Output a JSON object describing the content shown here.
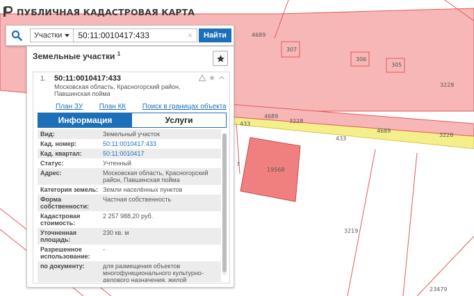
{
  "app": {
    "title": "ПУБЛИЧНАЯ КАДАСТРОВАЯ КАРТА"
  },
  "search": {
    "type_label": "Участки",
    "value": "50:11:0010417:433",
    "button_label": "Найти",
    "clear_glyph": "×"
  },
  "panel": {
    "title": "Земельные участки",
    "count": "1"
  },
  "card": {
    "index": "1.",
    "cadastral_number": "50:11:0010417:433",
    "address": "Московская область, Красногорский район, Павшинская пойма",
    "links": [
      {
        "label": "План ЗУ →"
      },
      {
        "label": "План КК →"
      },
      {
        "label": "Поиск в границах объекта →"
      }
    ],
    "tabs": [
      {
        "label": "Информация",
        "active": true
      },
      {
        "label": "Услуги",
        "active": false
      }
    ],
    "properties": [
      {
        "label": "Вид:",
        "value": "Земельный участок"
      },
      {
        "label": "Кад. номер:",
        "value": "50:11:0010417:433",
        "link": true
      },
      {
        "label": "Кад. квартал:",
        "value": "50:11:0010417",
        "link": true
      },
      {
        "label": "Статус:",
        "value": "Учтенный"
      },
      {
        "label": "Адрес:",
        "value": "Московская область, Красногорский район, Павшинская пойма"
      },
      {
        "label": "Категория земель:",
        "value": "Земли населённых пунктов"
      },
      {
        "label": "Форма собственности:",
        "value": "Частная собственность"
      },
      {
        "label": "Кадастровая стоимость:",
        "value": "2 257 988,20 руб."
      },
      {
        "label": "Уточненная площадь:",
        "value": "230 кв. м"
      },
      {
        "label": "Разрешенное использование:",
        "value": "-"
      },
      {
        "label": "по документу:",
        "value": "для размещения объектов многофункционального культурно-делового назначения, жилой застройки, гостиничного комплекса и спортивного назначения"
      }
    ]
  },
  "map": {
    "labels": [
      {
        "text": "4689"
      },
      {
        "text": "307"
      },
      {
        "text": "306"
      },
      {
        "text": "305"
      },
      {
        "text": "3228"
      },
      {
        "text": "433"
      },
      {
        "text": "4689"
      },
      {
        "text": "3228"
      },
      {
        "text": "4689"
      },
      {
        "text": "433"
      },
      {
        "text": "3228"
      },
      {
        "text": "19568"
      },
      {
        "text": "3219"
      },
      {
        "text": "23479"
      },
      {
        "text": "7"
      }
    ]
  },
  "colors": {
    "accent": "#1d6fb8",
    "parcel_fill": "#f7b7b7",
    "parcel_border": "#e05a5a",
    "road_fill": "#f4ef8a",
    "highlight_fill": "#f08080"
  }
}
